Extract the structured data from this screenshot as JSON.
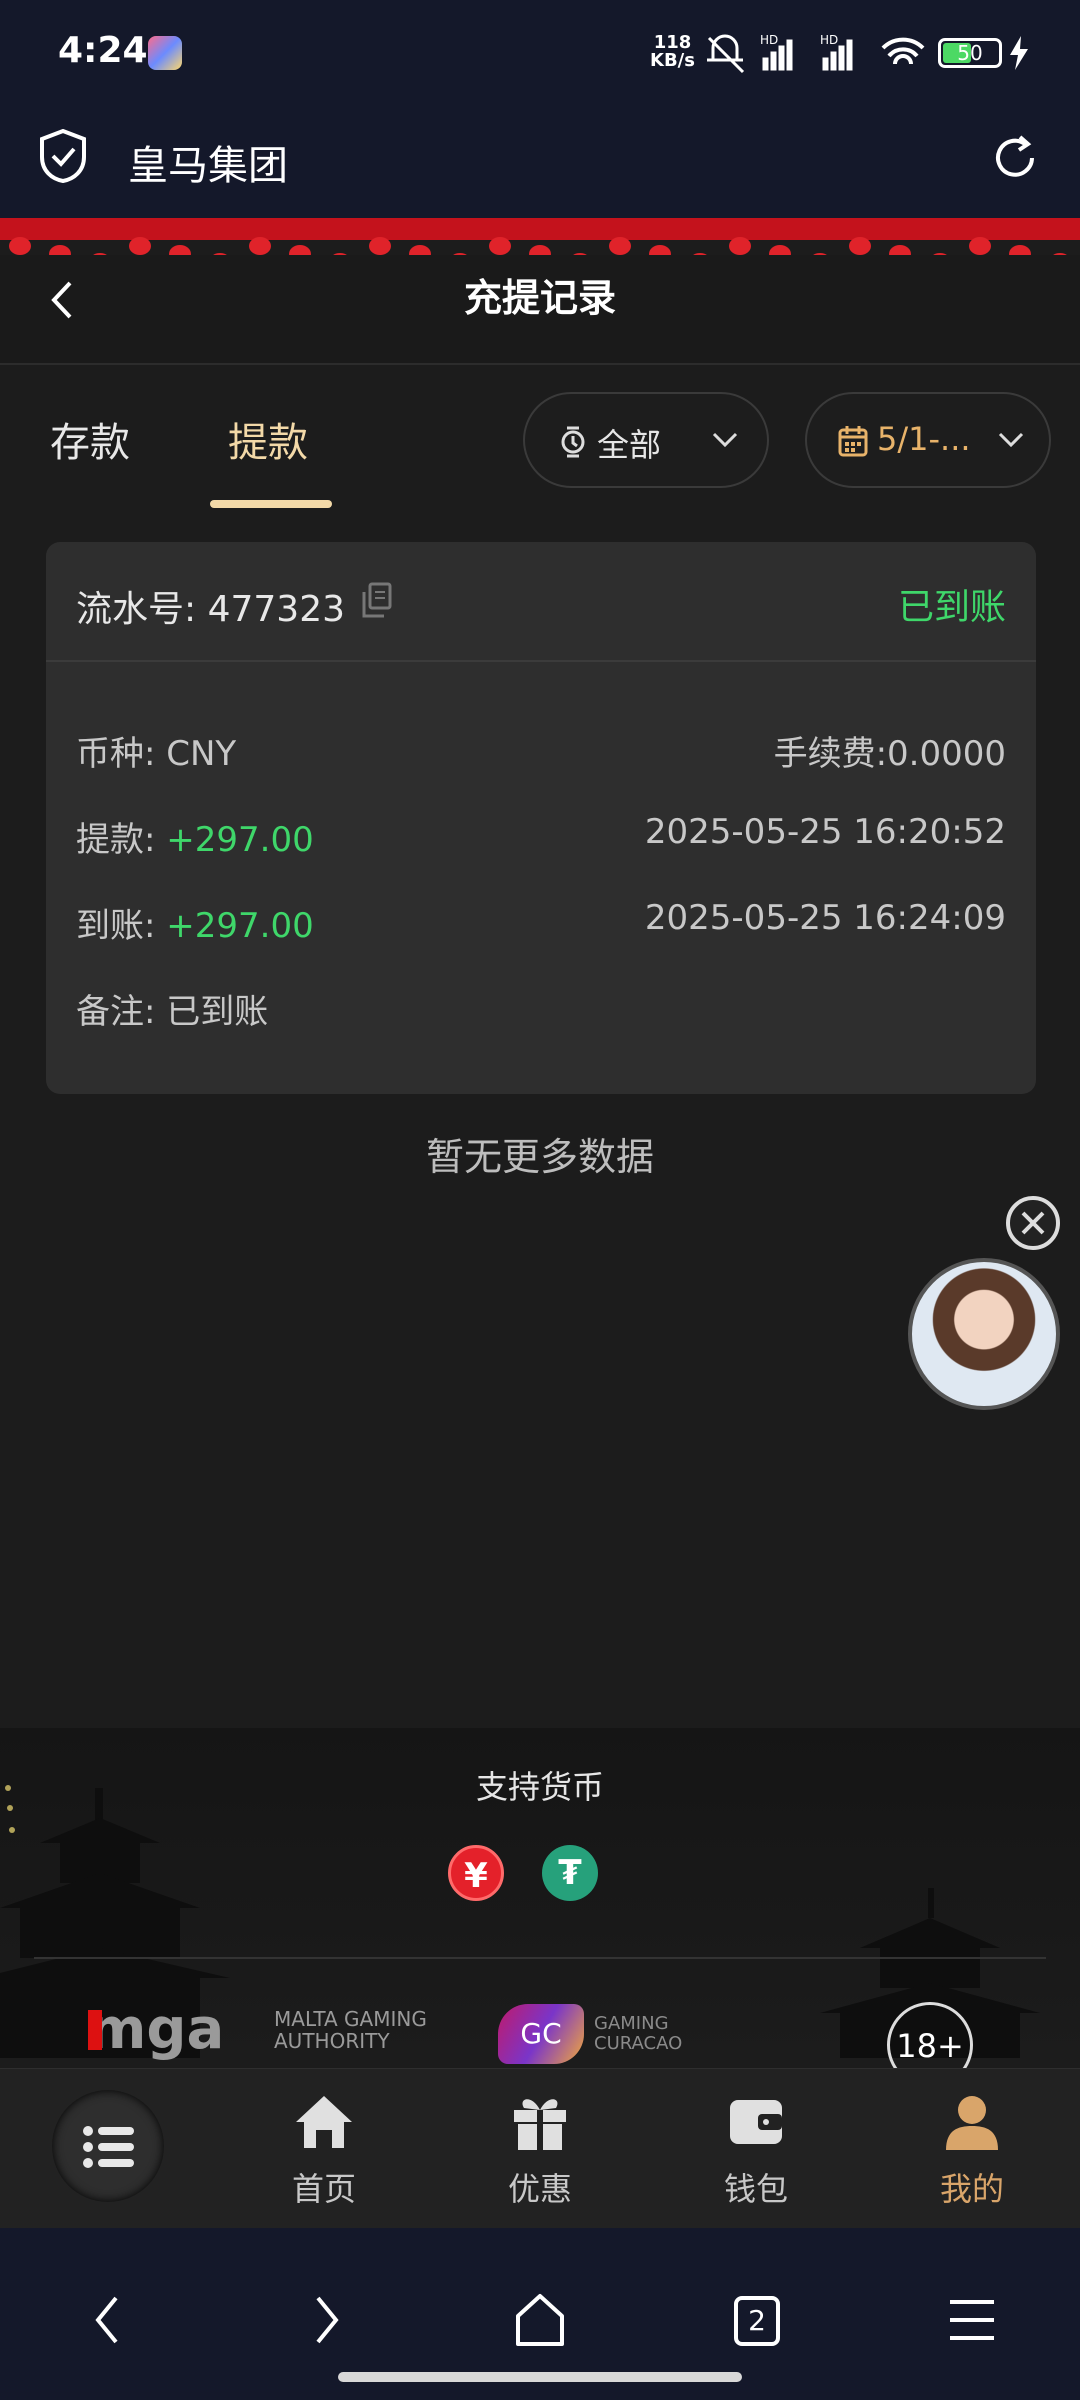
{
  "status_bar": {
    "time": "4:24",
    "net_speed_value": "118",
    "net_speed_unit": "KB/s",
    "battery": "50"
  },
  "app_header": {
    "title": "皇马集团"
  },
  "nav": {
    "title": "充提记录"
  },
  "tabs": {
    "deposit": "存款",
    "withdraw": "提款"
  },
  "filters": {
    "status": "全部",
    "date": "5/1-..."
  },
  "record": {
    "serial_label": "流水号: 477323",
    "status": "已到账",
    "currency_label": "币种: CNY",
    "fee_label": "手续费:0.0000",
    "withdraw_label": "提款: ",
    "withdraw_amount": "+297.00",
    "withdraw_time": "2025-05-25 16:20:52",
    "arrive_label": "到账: ",
    "arrive_amount": "+297.00",
    "arrive_time": "2025-05-25 16:24:09",
    "note_label": "备注: 已到账"
  },
  "no_more": "暂无更多数据",
  "footer": {
    "currency_title": "支持货币",
    "cny_symbol": "¥",
    "usdt_symbol": "₮",
    "mga_text": "mga",
    "mga_sub1": "MALTA GAMING",
    "mga_sub2": "AUTHORITY",
    "gc_text": "GC",
    "gc_sub1": "GAMING",
    "gc_sub2": "CURACAO",
    "age": "18+"
  },
  "tabbar": {
    "home": "首页",
    "promo": "优惠",
    "wallet": "钱包",
    "mine": "我的"
  },
  "system_nav": {
    "tab_count": "2"
  },
  "colors": {
    "accent": "#f3d9a8",
    "success": "#3fd76a",
    "header_bg": "#14182a"
  }
}
